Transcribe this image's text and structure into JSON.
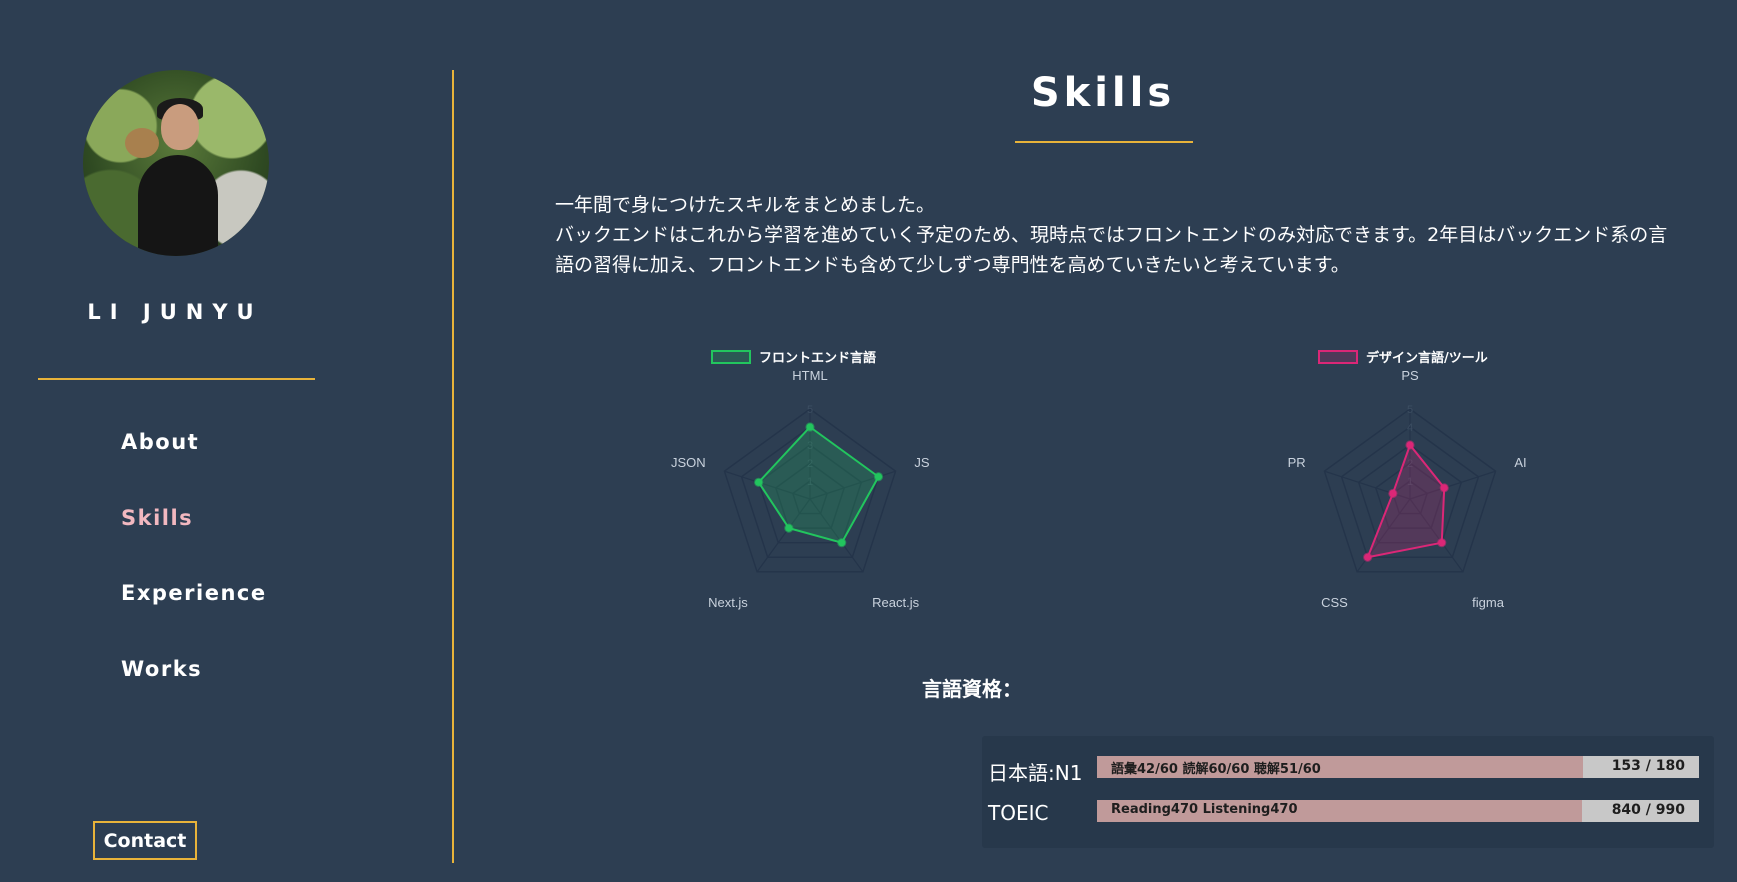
{
  "sidebar": {
    "name": "LI JUNYU",
    "nav": [
      "About",
      "Skills",
      "Experience",
      "Works"
    ],
    "active": "Skills",
    "contact_label": "Contact"
  },
  "main": {
    "title": "Skills",
    "intro": [
      "一年間で身につけたスキルをまとめました。",
      "バックエンドはこれから学習を進めていく予定のため、現時点ではフロントエンドのみ対応できます。2年目はバックエンド系の言語の習得に加え、フロントエンドも含めて少しずつ専門性を高めていきたいと考えています。"
    ],
    "lang_heading": "言語資格："
  },
  "chart_data": [
    {
      "type": "radar",
      "legend": "フロントエンド言語",
      "color": "#22c55e",
      "axes": [
        "HTML",
        "JS",
        "React.js",
        "Next.js",
        "JSON"
      ],
      "values": [
        4,
        4,
        3,
        2,
        3
      ],
      "scale_ticks": [
        "1",
        "2",
        "3",
        "4",
        "5"
      ],
      "range": [
        0,
        5
      ]
    },
    {
      "type": "radar",
      "legend": "デザイン言語/ツール",
      "color": "#db2777",
      "axes": [
        "PS",
        "AI",
        "figma",
        "CSS",
        "PR"
      ],
      "values": [
        3,
        2,
        3,
        4,
        1
      ],
      "scale_ticks": [
        "1",
        "2",
        "3",
        "4",
        "5"
      ],
      "range": [
        0,
        5
      ]
    }
  ],
  "certifications": [
    {
      "label": "日本語:N1",
      "detail": "語彙42/60 読解60/60 聴解51/60",
      "score": 153,
      "max": 180,
      "score_text": "153 / 180"
    },
    {
      "label": "TOEIC",
      "detail": "Reading470 Listening470",
      "score": 840,
      "max": 990,
      "score_text": "840 / 990"
    }
  ],
  "colors": {
    "accent": "#e8b33a",
    "active_nav": "#f2b8c0",
    "background": "#2d3e52"
  }
}
